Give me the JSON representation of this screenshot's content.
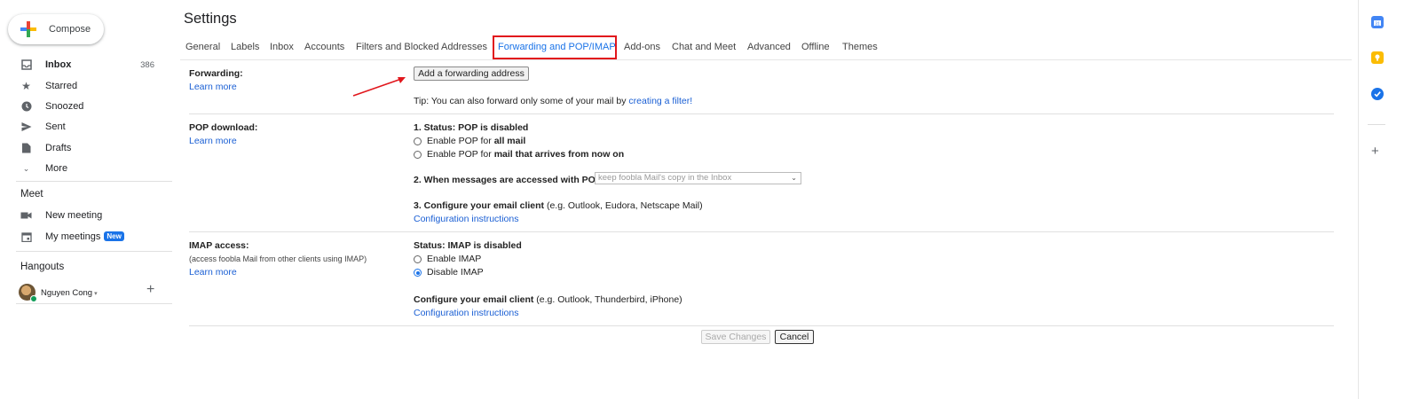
{
  "compose": {
    "label": "Compose"
  },
  "sidebar": {
    "items": [
      {
        "label": "Inbox",
        "count": "386",
        "icon": "inbox-icon"
      },
      {
        "label": "Starred",
        "icon": "star-icon"
      },
      {
        "label": "Snoozed",
        "icon": "clock-icon"
      },
      {
        "label": "Sent",
        "icon": "send-icon"
      },
      {
        "label": "Drafts",
        "icon": "draft-icon"
      },
      {
        "label": "More",
        "icon": "chevron-down-icon"
      }
    ],
    "meet": {
      "title": "Meet",
      "items": [
        {
          "label": "New meeting",
          "icon": "video-icon"
        },
        {
          "label": "My meetings",
          "badge": "New",
          "icon": "calendar-icon"
        }
      ]
    },
    "hangouts": {
      "title": "Hangouts",
      "user": "Nguyen Cong"
    }
  },
  "settings": {
    "title": "Settings",
    "tabs": [
      {
        "label": "General"
      },
      {
        "label": "Labels"
      },
      {
        "label": "Inbox"
      },
      {
        "label": "Accounts"
      },
      {
        "label": "Filters and Blocked Addresses"
      },
      {
        "label": "Forwarding and POP/IMAP",
        "active": true
      },
      {
        "label": "Add-ons"
      },
      {
        "label": "Chat and Meet"
      },
      {
        "label": "Advanced"
      },
      {
        "label": "Offline"
      },
      {
        "label": "Themes"
      }
    ],
    "forwarding": {
      "label": "Forwarding:",
      "learn_more": "Learn more",
      "add_button": "Add a forwarding address",
      "tip_prefix": "Tip: You can also forward only some of your mail by ",
      "tip_link": "creating a filter!"
    },
    "pop": {
      "label": "POP download:",
      "learn_more": "Learn more",
      "status": "1. Status: POP is disabled",
      "option1_prefix": "Enable POP for ",
      "option1_bold": "all mail",
      "option2_prefix": "Enable POP for ",
      "option2_bold": "mail that arrives from now on",
      "when_label": "2. When messages are accessed with POP",
      "when_select": "keep foobla Mail's copy in the Inbox",
      "configure_bold": "3. Configure your email client",
      "configure_rest": " (e.g. Outlook, Eudora, Netscape Mail)",
      "instructions": "Configuration instructions"
    },
    "imap": {
      "label": "IMAP access:",
      "sub": "(access foobla Mail from other clients using IMAP)",
      "learn_more": "Learn more",
      "status": "Status: IMAP is disabled",
      "enable": "Enable IMAP",
      "disable": "Disable IMAP",
      "selected": "disable",
      "configure_bold": "Configure your email client",
      "configure_rest": " (e.g. Outlook, Thunderbird, iPhone)",
      "instructions": "Configuration instructions"
    },
    "actions": {
      "save": "Save Changes",
      "cancel": "Cancel"
    }
  },
  "colors": {
    "accent": "#1a73e8",
    "highlight_box": "#e1161c",
    "arrow": "#e1161c"
  }
}
